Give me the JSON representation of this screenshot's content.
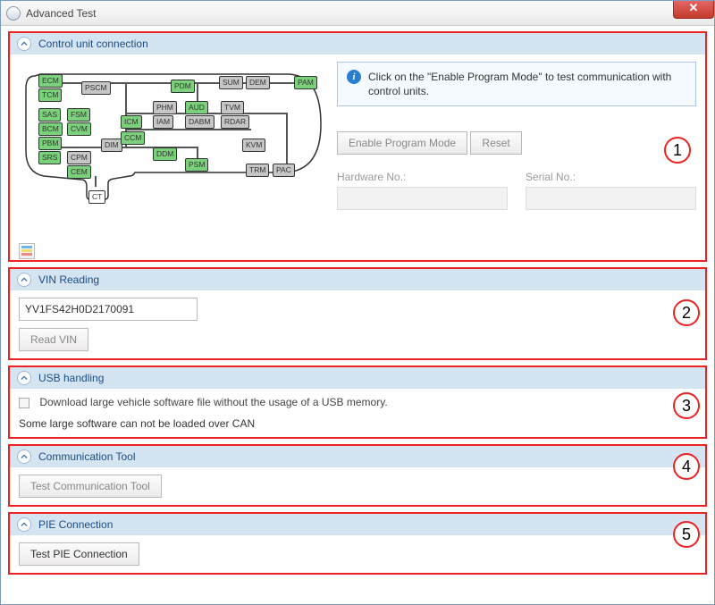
{
  "window": {
    "title": "Advanced Test"
  },
  "annotations": {
    "a1": "1",
    "a2": "2",
    "a3": "3",
    "a4": "4",
    "a5": "5"
  },
  "panel1": {
    "title": "Control unit connection",
    "info_text": "Click on the \"Enable Program Mode\" to test communication with control units.",
    "enable_btn": "Enable Program Mode",
    "reset_btn": "Reset",
    "hw_label": "Hardware No.:",
    "hw_value": "",
    "sn_label": "Serial No.:",
    "sn_value": "",
    "nodes": {
      "ecm": "ECM",
      "tcm": "TCM",
      "sas": "SAS",
      "bcm": "BCM",
      "pbm": "PBM",
      "srs": "SRS",
      "fsm": "FSM",
      "cvm": "CVM",
      "cpm": "CPM",
      "cem": "CEM",
      "pscm": "PSCM",
      "dim": "DIM",
      "icm": "ICM",
      "ccm": "CCM",
      "phm": "PHM",
      "iam": "IAM",
      "ddm": "DDM",
      "pdm": "PDM",
      "aud": "AUD",
      "dabm": "DABM",
      "psm": "PSM",
      "sum": "SUM",
      "dem": "DEM",
      "tvm": "TVM",
      "rdar": "RDAR",
      "kvm": "KVM",
      "trm": "TRM",
      "pac": "PAC",
      "pam": "PAM",
      "ct": "CT"
    }
  },
  "panel2": {
    "title": "VIN Reading",
    "vin_value": "YV1FS42H0D2170091",
    "read_btn": "Read VIN"
  },
  "panel3": {
    "title": "USB handling",
    "checkbox_label": "Download large vehicle software file without the usage of a USB memory.",
    "note": "Some large software can not be loaded over CAN"
  },
  "panel4": {
    "title": "Communication Tool",
    "test_btn": "Test Communication Tool"
  },
  "panel5": {
    "title": "PIE Connection",
    "test_btn": "Test PIE Connection"
  }
}
